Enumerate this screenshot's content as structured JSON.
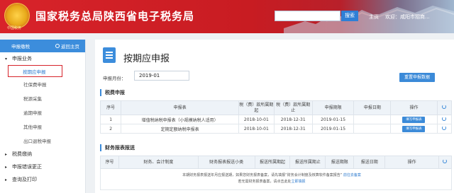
{
  "header": {
    "site_title": "国家税务总局陕西省电子税务局",
    "emblem_text": "中国税务",
    "search_button": "搜索",
    "links": [
      "主页",
      "欢迎：咸阳市招商..."
    ]
  },
  "sidebar": {
    "header_label": "申报缴税",
    "back_label": "返回主页",
    "groups": [
      {
        "label": "申报业务",
        "expanded": true
      },
      {
        "label": "税费缴纳",
        "expanded": false
      },
      {
        "label": "申报错误更正",
        "expanded": false
      },
      {
        "label": "查询及打印",
        "expanded": false
      }
    ],
    "items": [
      "按期应申报",
      "社保费申报",
      "税源采集",
      "逾期申报",
      "其他申报",
      "出口退税申报"
    ]
  },
  "main": {
    "title": "按期应申报",
    "period_label": "申报月份：",
    "period_value": "2019-01",
    "refresh_button": "重置申报数据",
    "tax_section_title": "税费申报",
    "tax_table": {
      "headers": [
        "序号",
        "申报表",
        "税（费）款所属期起",
        "税（费）款所属期止",
        "申报期限",
        "申报日期",
        "操作"
      ],
      "rows": [
        [
          "1",
          "增值税纳税申报表（小规模纳税人适用）",
          "2018-10-01",
          "2018-12-31",
          "2019-01-15",
          "",
          "填写申报表"
        ],
        [
          "2",
          "定期定额纳税申报表",
          "2018-10-01",
          "2018-12-31",
          "2019-01-15",
          "",
          "填写申报表"
        ]
      ]
    },
    "fin_section_title": "财务报表报送",
    "fin_table": {
      "headers": [
        "序号",
        "财务、会计制度",
        "财务报表报送小类",
        "报送所属期起",
        "报送所属期止",
        "报送期限",
        "报送日期",
        "操作"
      ]
    },
    "note_line1": "本期财务报表报送年月应报送期，如果您财务报表备案，请先填报“财务会计制度及核算软件备案报告”",
    "note_link1": "前往去备案",
    "note_line2": "若无需财务报表备案，请点击此处",
    "note_link2": "立即填报"
  },
  "colors": {
    "brand_red": "#d8232a",
    "accent_blue": "#3b8ad8"
  }
}
